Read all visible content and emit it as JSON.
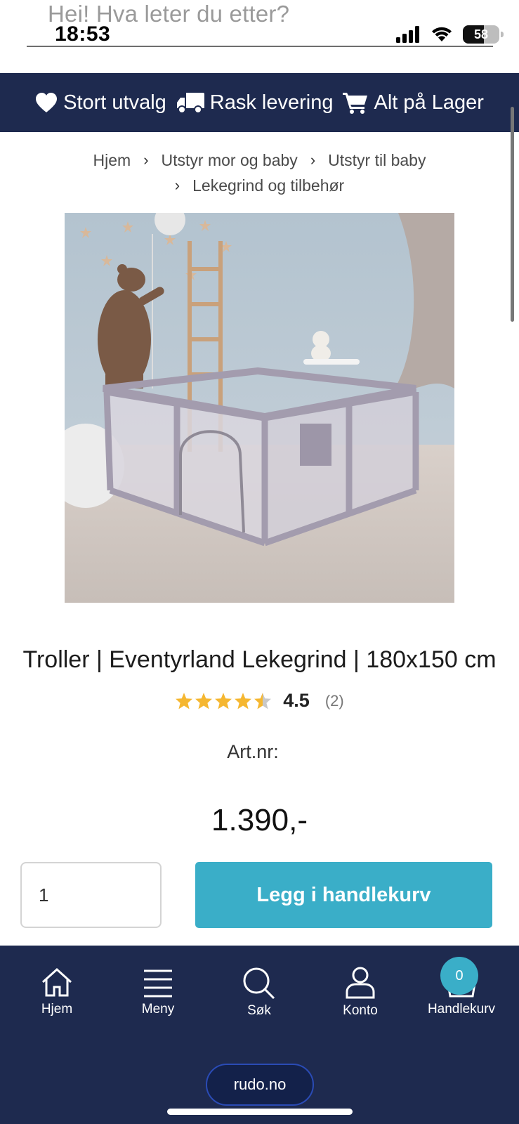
{
  "status_bar": {
    "time": "18:53",
    "battery_level": "58",
    "icons": [
      "cellular-icon",
      "wifi-icon",
      "battery-icon"
    ]
  },
  "search": {
    "placeholder": "Hei! Hva leter du etter?"
  },
  "usp_banner": {
    "items": [
      {
        "icon": "heart-icon",
        "label": "Stort utvalg"
      },
      {
        "icon": "truck-icon",
        "label": "Rask levering"
      },
      {
        "icon": "shopping-cart-icon",
        "label": "Alt på Lager"
      }
    ]
  },
  "breadcrumb": {
    "items": [
      "Hjem",
      "Utstyr mor og baby",
      "Utstyr til baby",
      "Lekegrind og tilbehør"
    ]
  },
  "product": {
    "image_alt": "",
    "title": "Troller | Eventyrland Lekegrind | 180x150 cm",
    "rating": "4.5",
    "rating_fraction": 0.9,
    "review_count": "(2)",
    "artnr_label": "Art.nr:",
    "price": "1.390,-",
    "quantity": "1",
    "add_to_cart_label": "Legg i handlekurv"
  },
  "bottom_nav": {
    "items": [
      {
        "icon": "home-icon",
        "label": "Hjem"
      },
      {
        "icon": "menu-icon",
        "label": "Meny"
      },
      {
        "icon": "search-icon",
        "label": "Søk"
      },
      {
        "icon": "user-icon",
        "label": "Konto"
      },
      {
        "icon": "basket-icon",
        "label": "Handlekurv"
      }
    ],
    "cart_count": "0"
  },
  "browser": {
    "url": "rudo.no"
  },
  "colors": {
    "navy": "#1e2a4f",
    "accent": "#3aaec8",
    "star": "#f5b731"
  }
}
